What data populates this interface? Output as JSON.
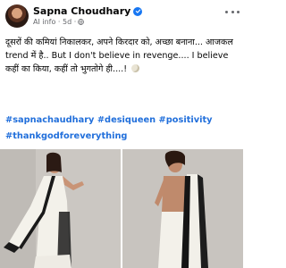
{
  "post": {
    "author_name": "Sapna Choudhary",
    "meta": "AI info · 5d ·",
    "text": "दूसरों की कमियां निकालकर, अपने किरदार को, अच्छा बनाना... आजकल trend में है.. But I don't believe in revenge.... I believe कहीं का किया, कहीं तो भुगतोगे ही....! ",
    "hashtags": "#sapnachaudhary #desiqueen #positivity #thankgodforeverything"
  },
  "icons": {
    "verified": "verified-badge-icon",
    "privacy": "globe-icon",
    "more": "more-options-icon",
    "emoji": "crescent-moon-emoji"
  },
  "colors": {
    "hashtag": "#216fdb",
    "verified": "#1877f2",
    "meta_text": "#65676b"
  }
}
